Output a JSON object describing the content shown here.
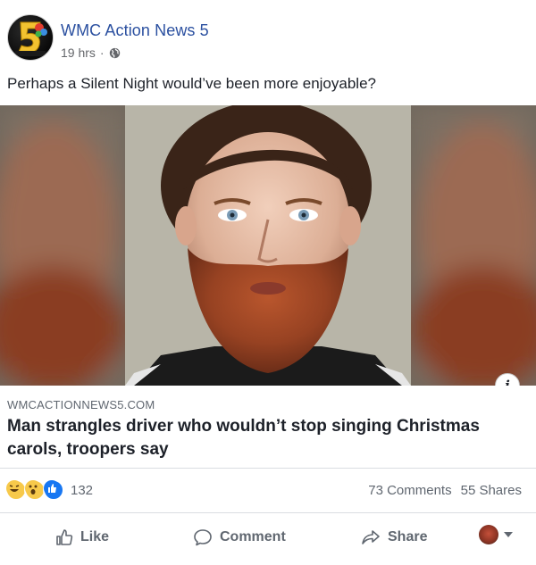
{
  "post": {
    "page_name": "WMC Action News 5",
    "time": "19 hrs",
    "separator": "·",
    "privacy_icon": "globe-icon",
    "caption": "Perhaps a Silent Night would’ve been more enjoyable?"
  },
  "link_preview": {
    "domain": "WMCACTIONNEWS5.COM",
    "headline": "Man strangles driver who wouldn’t stop singing Christmas carols, troopers say",
    "info_icon": "i"
  },
  "engagement": {
    "reaction_icons": [
      "haha-icon",
      "wow-icon",
      "like-icon"
    ],
    "reaction_count": "132",
    "comments": "73 Comments",
    "shares": "55 Shares"
  },
  "actions": {
    "like": "Like",
    "comment": "Comment",
    "share": "Share"
  },
  "colors": {
    "page_name": "#2b50a0",
    "secondary_text": "#606770",
    "divider": "#dadde1",
    "like_blue": "#1877f2",
    "haha_yellow": "#f7c94b"
  }
}
